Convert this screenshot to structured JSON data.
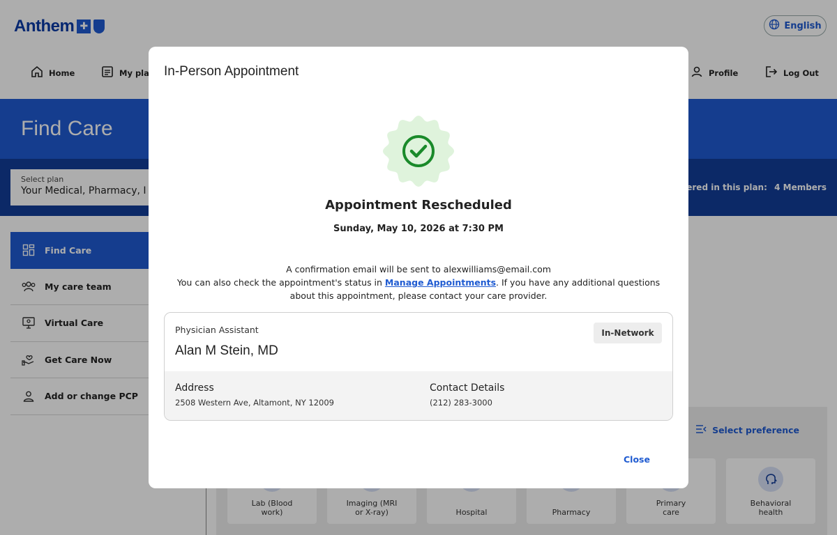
{
  "header": {
    "logo_text": "Anthem",
    "language_label": "English"
  },
  "nav": {
    "home": "Home",
    "my_plan": "My plan",
    "profile": "Profile",
    "logout": "Log Out"
  },
  "hero": {
    "title": "Find Care"
  },
  "plan": {
    "label": "Select plan",
    "value": "Your Medical, Pharmacy, I",
    "members_label": "covered in this plan:",
    "members_value": "4 Members"
  },
  "sidebar": {
    "items": [
      {
        "label": "Find Care",
        "icon": "grid-icon"
      },
      {
        "label": "My care team",
        "icon": "team-icon"
      },
      {
        "label": "Virtual Care",
        "icon": "monitor-icon"
      },
      {
        "label": "Get Care Now",
        "icon": "hand-heart-icon"
      },
      {
        "label": "Add or change PCP",
        "icon": "person-icon"
      }
    ]
  },
  "preferences": {
    "label": "Select preference"
  },
  "care_cards": [
    {
      "label": "Lab (Blood work)"
    },
    {
      "label": "Imaging (MRI or X-ray)"
    },
    {
      "label": "Hospital"
    },
    {
      "label": "Pharmacy"
    },
    {
      "label": "Primary care"
    },
    {
      "label": "Behavioral health"
    }
  ],
  "modal": {
    "title": "In-Person Appointment",
    "status_title": "Appointment Rescheduled",
    "status_date": "Sunday, May 10, 2026 at 7:30 PM",
    "email_line": "A confirmation email will be sent to alexwilliams@email.com",
    "status_line_pre": "You can also check the appointment's status in ",
    "status_link": "Manage Appointments",
    "status_line_post": ". If you have any additional questions about this appointment, please contact your care provider.",
    "provider": {
      "type": "Physician Assistant",
      "name": "Alan M Stein, MD",
      "network": "In-Network",
      "address_label": "Address",
      "address": "2508 Western Ave, Altamont, NY 12009",
      "contact_label": "Contact Details",
      "phone": "(212) 283-3000"
    },
    "close_label": "Close"
  },
  "colors": {
    "brand_blue": "#1f5bd1",
    "dark_blue": "#123d99",
    "success_green": "#1a8a2a",
    "success_bg": "#dff3dc"
  }
}
